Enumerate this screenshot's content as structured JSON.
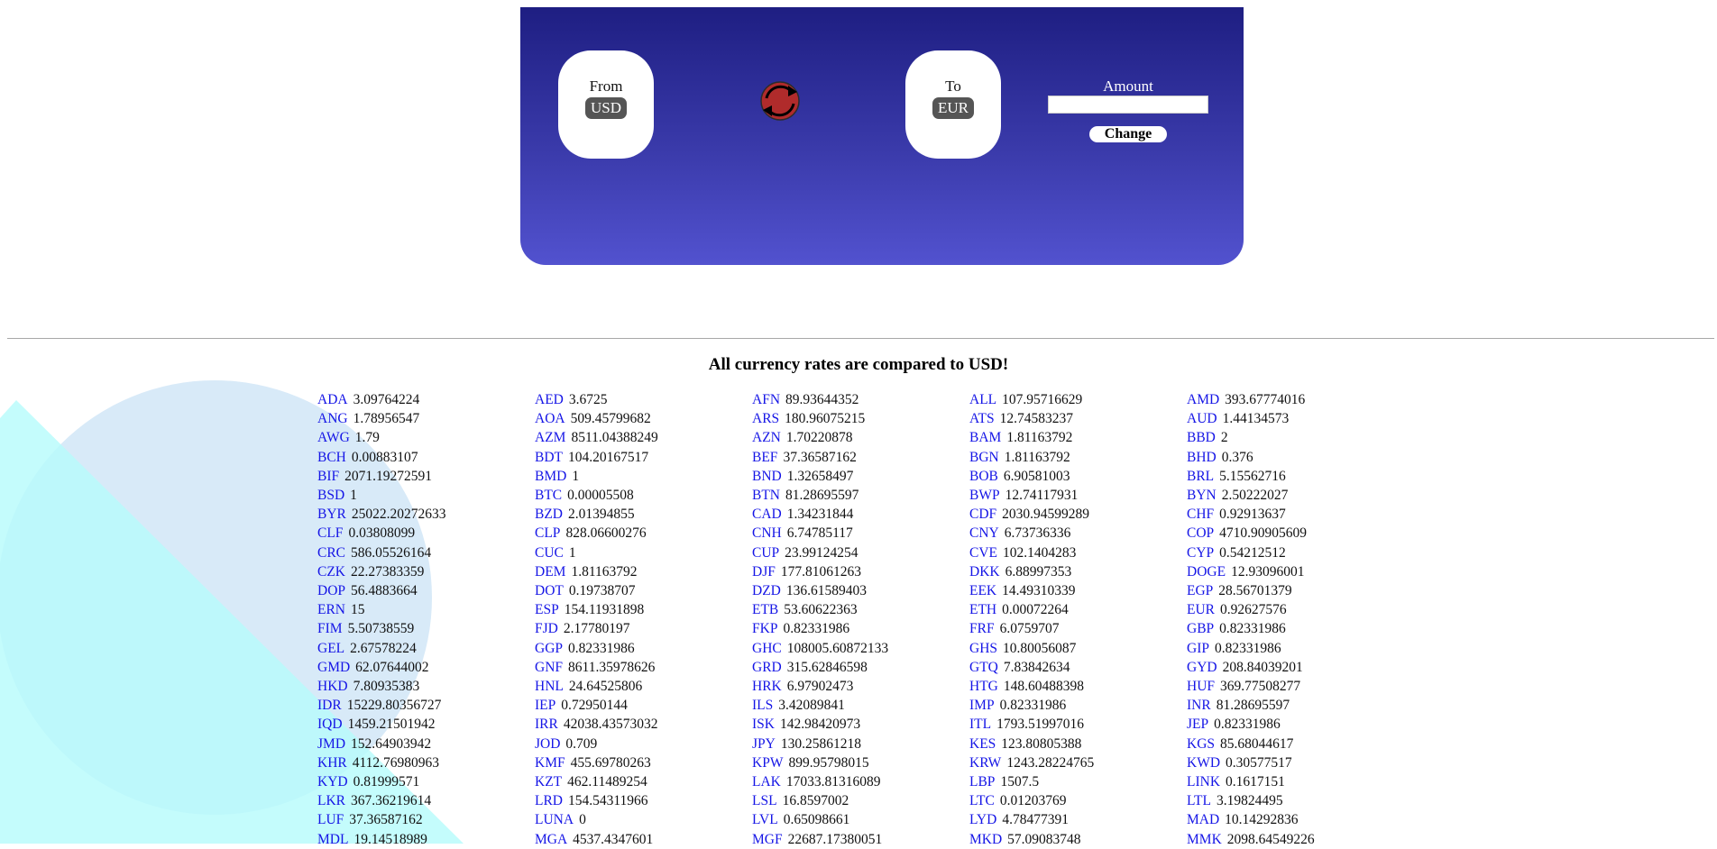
{
  "converter": {
    "from_label": "From",
    "from_code": "USD",
    "to_label": "To",
    "to_code": "EUR",
    "amount_label": "Amount",
    "amount_value": "",
    "change_label": "Change",
    "swap_icon": "refresh-icon"
  },
  "colors": {
    "panel_top": "#1e1e82",
    "panel_bottom": "#5252cf",
    "swap_fill": "#b02b2b",
    "code_link": "#1515e6",
    "bg_circle": "#d8eaf8",
    "bg_triangle": "#b7fbfb"
  },
  "heading": "All currency rates are compared to USD!",
  "rates": [
    {
      "code": "ADA",
      "value": "3.09764224"
    },
    {
      "code": "AED",
      "value": "3.6725"
    },
    {
      "code": "AFN",
      "value": "89.93644352"
    },
    {
      "code": "ALL",
      "value": "107.95716629"
    },
    {
      "code": "AMD",
      "value": "393.67774016"
    },
    {
      "code": "ANG",
      "value": "1.78956547"
    },
    {
      "code": "AOA",
      "value": "509.45799682"
    },
    {
      "code": "ARS",
      "value": "180.96075215"
    },
    {
      "code": "ATS",
      "value": "12.74583237"
    },
    {
      "code": "AUD",
      "value": "1.44134573"
    },
    {
      "code": "AWG",
      "value": "1.79"
    },
    {
      "code": "AZM",
      "value": "8511.04388249"
    },
    {
      "code": "AZN",
      "value": "1.70220878"
    },
    {
      "code": "BAM",
      "value": "1.81163792"
    },
    {
      "code": "BBD",
      "value": "2"
    },
    {
      "code": "BCH",
      "value": "0.00883107"
    },
    {
      "code": "BDT",
      "value": "104.20167517"
    },
    {
      "code": "BEF",
      "value": "37.36587162"
    },
    {
      "code": "BGN",
      "value": "1.81163792"
    },
    {
      "code": "BHD",
      "value": "0.376"
    },
    {
      "code": "BIF",
      "value": "2071.19272591"
    },
    {
      "code": "BMD",
      "value": "1"
    },
    {
      "code": "BND",
      "value": "1.32658497"
    },
    {
      "code": "BOB",
      "value": "6.90581003"
    },
    {
      "code": "BRL",
      "value": "5.15562716"
    },
    {
      "code": "BSD",
      "value": "1"
    },
    {
      "code": "BTC",
      "value": "0.00005508"
    },
    {
      "code": "BTN",
      "value": "81.28695597"
    },
    {
      "code": "BWP",
      "value": "12.74117931"
    },
    {
      "code": "BYN",
      "value": "2.50222027"
    },
    {
      "code": "BYR",
      "value": "25022.20272633"
    },
    {
      "code": "BZD",
      "value": "2.01394855"
    },
    {
      "code": "CAD",
      "value": "1.34231844"
    },
    {
      "code": "CDF",
      "value": "2030.94599289"
    },
    {
      "code": "CHF",
      "value": "0.92913637"
    },
    {
      "code": "CLF",
      "value": "0.03808099"
    },
    {
      "code": "CLP",
      "value": "828.06600276"
    },
    {
      "code": "CNH",
      "value": "6.74785117"
    },
    {
      "code": "CNY",
      "value": "6.73736336"
    },
    {
      "code": "COP",
      "value": "4710.90905609"
    },
    {
      "code": "CRC",
      "value": "586.05526164"
    },
    {
      "code": "CUC",
      "value": "1"
    },
    {
      "code": "CUP",
      "value": "23.99124254"
    },
    {
      "code": "CVE",
      "value": "102.1404283"
    },
    {
      "code": "CYP",
      "value": "0.54212512"
    },
    {
      "code": "CZK",
      "value": "22.27383359"
    },
    {
      "code": "DEM",
      "value": "1.81163792"
    },
    {
      "code": "DJF",
      "value": "177.81061263"
    },
    {
      "code": "DKK",
      "value": "6.88997353"
    },
    {
      "code": "DOGE",
      "value": "12.93096001"
    },
    {
      "code": "DOP",
      "value": "56.4883664"
    },
    {
      "code": "DOT",
      "value": "0.19738707"
    },
    {
      "code": "DZD",
      "value": "136.61589403"
    },
    {
      "code": "EEK",
      "value": "14.49310339"
    },
    {
      "code": "EGP",
      "value": "28.56701379"
    },
    {
      "code": "ERN",
      "value": "15"
    },
    {
      "code": "ESP",
      "value": "154.11931898"
    },
    {
      "code": "ETB",
      "value": "53.60622363"
    },
    {
      "code": "ETH",
      "value": "0.00072264"
    },
    {
      "code": "EUR",
      "value": "0.92627576"
    },
    {
      "code": "FIM",
      "value": "5.50738559"
    },
    {
      "code": "FJD",
      "value": "2.17780197"
    },
    {
      "code": "FKP",
      "value": "0.82331986"
    },
    {
      "code": "FRF",
      "value": "6.0759707"
    },
    {
      "code": "GBP",
      "value": "0.82331986"
    },
    {
      "code": "GEL",
      "value": "2.67578224"
    },
    {
      "code": "GGP",
      "value": "0.82331986"
    },
    {
      "code": "GHC",
      "value": "108005.60872133"
    },
    {
      "code": "GHS",
      "value": "10.80056087"
    },
    {
      "code": "GIP",
      "value": "0.82331986"
    },
    {
      "code": "GMD",
      "value": "62.07644002"
    },
    {
      "code": "GNF",
      "value": "8611.35978626"
    },
    {
      "code": "GRD",
      "value": "315.62846598"
    },
    {
      "code": "GTQ",
      "value": "7.83842634"
    },
    {
      "code": "GYD",
      "value": "208.84039201"
    },
    {
      "code": "HKD",
      "value": "7.80935383"
    },
    {
      "code": "HNL",
      "value": "24.64525806"
    },
    {
      "code": "HRK",
      "value": "6.97902473"
    },
    {
      "code": "HTG",
      "value": "148.60488398"
    },
    {
      "code": "HUF",
      "value": "369.77508277"
    },
    {
      "code": "IDR",
      "value": "15229.80356727"
    },
    {
      "code": "IEP",
      "value": "0.72950144"
    },
    {
      "code": "ILS",
      "value": "3.42089841"
    },
    {
      "code": "IMP",
      "value": "0.82331986"
    },
    {
      "code": "INR",
      "value": "81.28695597"
    },
    {
      "code": "IQD",
      "value": "1459.21501942"
    },
    {
      "code": "IRR",
      "value": "42038.43573032"
    },
    {
      "code": "ISK",
      "value": "142.98420973"
    },
    {
      "code": "ITL",
      "value": "1793.51997016"
    },
    {
      "code": "JEP",
      "value": "0.82331986"
    },
    {
      "code": "JMD",
      "value": "152.64903942"
    },
    {
      "code": "JOD",
      "value": "0.709"
    },
    {
      "code": "JPY",
      "value": "130.25861218"
    },
    {
      "code": "KES",
      "value": "123.80805388"
    },
    {
      "code": "KGS",
      "value": "85.68044617"
    },
    {
      "code": "KHR",
      "value": "4112.76980963"
    },
    {
      "code": "KMF",
      "value": "455.69780263"
    },
    {
      "code": "KPW",
      "value": "899.95798015"
    },
    {
      "code": "KRW",
      "value": "1243.28224765"
    },
    {
      "code": "KWD",
      "value": "0.30577517"
    },
    {
      "code": "KYD",
      "value": "0.81999571"
    },
    {
      "code": "KZT",
      "value": "462.11489254"
    },
    {
      "code": "LAK",
      "value": "17033.81316089"
    },
    {
      "code": "LBP",
      "value": "1507.5"
    },
    {
      "code": "LINK",
      "value": "0.1617151"
    },
    {
      "code": "LKR",
      "value": "367.36219614"
    },
    {
      "code": "LRD",
      "value": "154.54311966"
    },
    {
      "code": "LSL",
      "value": "16.8597002"
    },
    {
      "code": "LTC",
      "value": "0.01203769"
    },
    {
      "code": "LTL",
      "value": "3.19824495"
    },
    {
      "code": "LUF",
      "value": "37.36587162"
    },
    {
      "code": "LUNA",
      "value": "0"
    },
    {
      "code": "LVL",
      "value": "0.65098661"
    },
    {
      "code": "LYD",
      "value": "4.78477391"
    },
    {
      "code": "MAD",
      "value": "10.14292836"
    },
    {
      "code": "MDL",
      "value": "19.14518989"
    },
    {
      "code": "MGA",
      "value": "4537.4347601"
    },
    {
      "code": "MGF",
      "value": "22687.17380051"
    },
    {
      "code": "MKD",
      "value": "57.09083748"
    },
    {
      "code": "MMK",
      "value": "2098.64549226"
    }
  ]
}
